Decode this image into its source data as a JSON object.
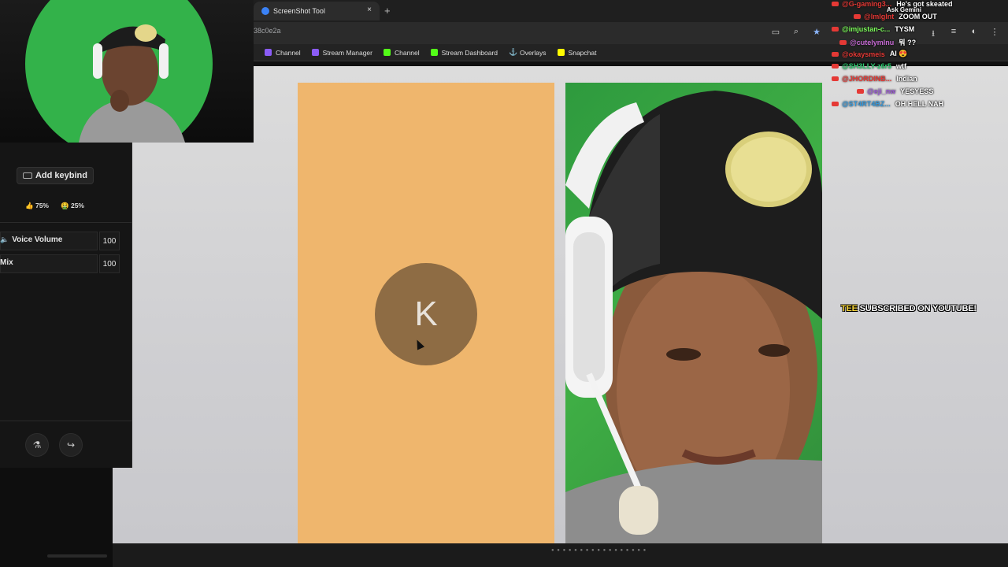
{
  "browser": {
    "tab_title": "ScreenShot Tool",
    "tab_close": "×",
    "new_tab": "+",
    "url": "38c0e2a",
    "bookmarks": [
      {
        "label": "Channel",
        "icon": "twitch-icon"
      },
      {
        "label": "Stream Manager",
        "icon": "twitch-icon"
      },
      {
        "label": "Channel",
        "icon": "kick-icon"
      },
      {
        "label": "Stream Dashboard",
        "icon": "kick-icon"
      },
      {
        "label": "Overlays",
        "icon": "anchor-icon"
      },
      {
        "label": "Snapchat",
        "icon": "snapchat-icon"
      }
    ]
  },
  "content": {
    "avatar_letter": "K"
  },
  "audio_panel": {
    "keybind_label": "Add keybind",
    "ratios": [
      {
        "emoji": "👍",
        "text": "75%"
      },
      {
        "emoji": "🤮",
        "text": "25%"
      }
    ],
    "rows": [
      {
        "label": "Voice Volume",
        "value": "100"
      },
      {
        "label": "Mix",
        "value": "100"
      }
    ]
  },
  "chat": {
    "ask_gemini": "Ask Gemini",
    "messages": [
      {
        "user": "@G-gaming3...",
        "text": "He's got skeated",
        "color": "#e53935"
      },
      {
        "user": "@lmlglnt",
        "text": "ZOOM OUT",
        "color": "#e53935"
      },
      {
        "user": "@imjustan-c...",
        "text": "TYSM",
        "color": "#7cfc5a"
      },
      {
        "user": "@cutelymlnu",
        "text": "뭐 ??",
        "color": "#c86bd6"
      },
      {
        "user": "@okaysmeis",
        "text": "AI 😍",
        "color": "#e53935"
      },
      {
        "user": "@SH3LLY-z6r5",
        "text": "wtf",
        "color": "#2ecc71"
      },
      {
        "user": "@JHORDINB...",
        "text": "Indian",
        "color": "#e53935"
      },
      {
        "user": "@eji_nw",
        "text": "YESYESS",
        "color": "#9b59d6"
      },
      {
        "user": "@ST4RT4BZ...",
        "text": "OH HELL NAH",
        "color": "#3498db"
      }
    ]
  },
  "alert": {
    "name": "TEE",
    "text": "SUBSCRIBED ON YOUTUBE!"
  }
}
